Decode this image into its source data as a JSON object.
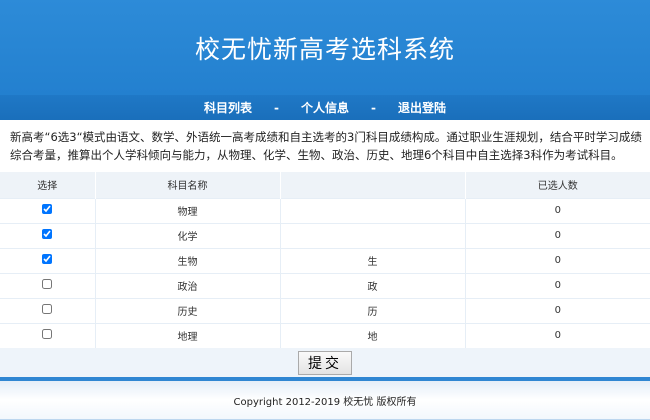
{
  "header": {
    "title": "校无忧新高考选科系统"
  },
  "nav": {
    "items": [
      "科目列表",
      "个人信息",
      "退出登陆"
    ],
    "separator": "-"
  },
  "intro": "新高考“6选3“模式由语文、数学、外语统一高考成绩和自主选考的3门科目成绩构成。通过职业生涯规划，结合平时学习成绩综合考量，推算出个人学科倾向与能力，从物理、化学、生物、政治、历史、地理6个科目中自主选择3科作为考试科目。",
  "table": {
    "headers": [
      "选择",
      "科目名称",
      "",
      "已选人数"
    ],
    "rows": [
      {
        "checked": true,
        "name": "物理",
        "abbr": "",
        "count": "0"
      },
      {
        "checked": true,
        "name": "化学",
        "abbr": "",
        "count": "0"
      },
      {
        "checked": true,
        "name": "生物",
        "abbr": "生",
        "count": "0"
      },
      {
        "checked": false,
        "name": "政治",
        "abbr": "政",
        "count": "0"
      },
      {
        "checked": false,
        "name": "历史",
        "abbr": "历",
        "count": "0"
      },
      {
        "checked": false,
        "name": "地理",
        "abbr": "地",
        "count": "0"
      }
    ]
  },
  "submit_label": "提交",
  "footer": "Copyright 2012-2019 校无忧 版权所有"
}
